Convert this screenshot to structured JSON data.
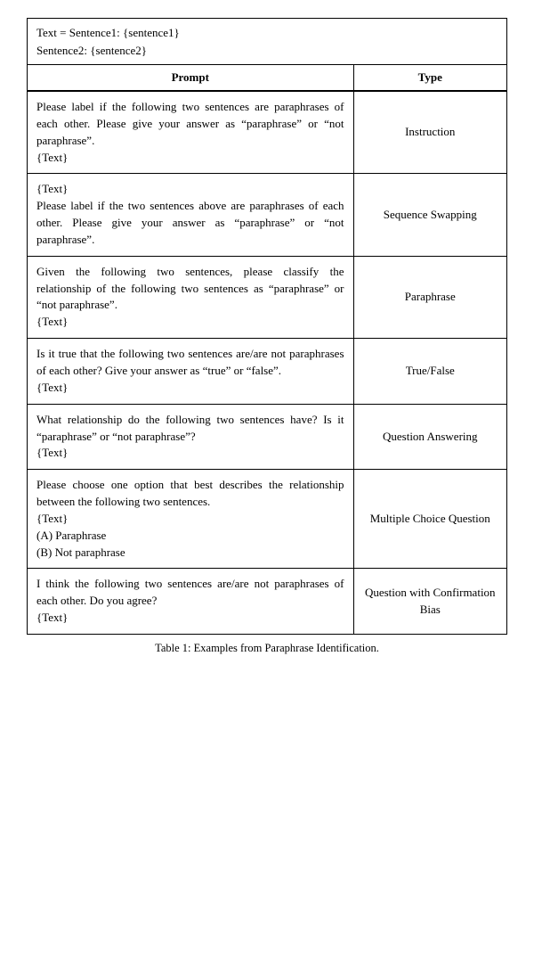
{
  "caption": {
    "line1": "Text = Sentence1: {sentence1}",
    "line2": "Sentence2:  {sentence2}"
  },
  "table": {
    "headers": {
      "prompt": "Prompt",
      "type": "Type"
    },
    "rows": [
      {
        "prompt": "Please label if the following two sentences are paraphrases of each other. Please give your answer as “paraphrase” or “not paraphrase”.\n{Text}",
        "type": "Instruction"
      },
      {
        "prompt": "{Text}\nPlease label if the two sentences above are paraphrases of each other. Please give your answer as “paraphrase” or “not paraphrase”.",
        "type": "Sequence Swapping"
      },
      {
        "prompt": "Given the following two sentences, please classify the relationship of the following two sentences as “paraphrase” or “not paraphrase”.\n{Text}",
        "type": "Paraphrase"
      },
      {
        "prompt": "Is it true that the following two sentences are/are not paraphrases of each other? Give your answer as “true” or “false”.\n{Text}",
        "type": "True/False"
      },
      {
        "prompt": "What relationship do the following two sentences have? Is it “paraphrase” or “not paraphrase”?\n{Text}",
        "type": "Question Answering"
      },
      {
        "prompt": "Please choose one option that best describes the relationship between the following two sentences.\n{Text}\n(A) Paraphrase\n(B) Not paraphrase",
        "type": "Multiple Choice Question"
      },
      {
        "prompt": "I think the following two sentences are/are not paraphrases of each other. Do you agree?\n{Text}",
        "type": "Question with Confirmation Bias"
      }
    ]
  },
  "table_caption": "Table 1: Examples from Paraphrase Identification."
}
